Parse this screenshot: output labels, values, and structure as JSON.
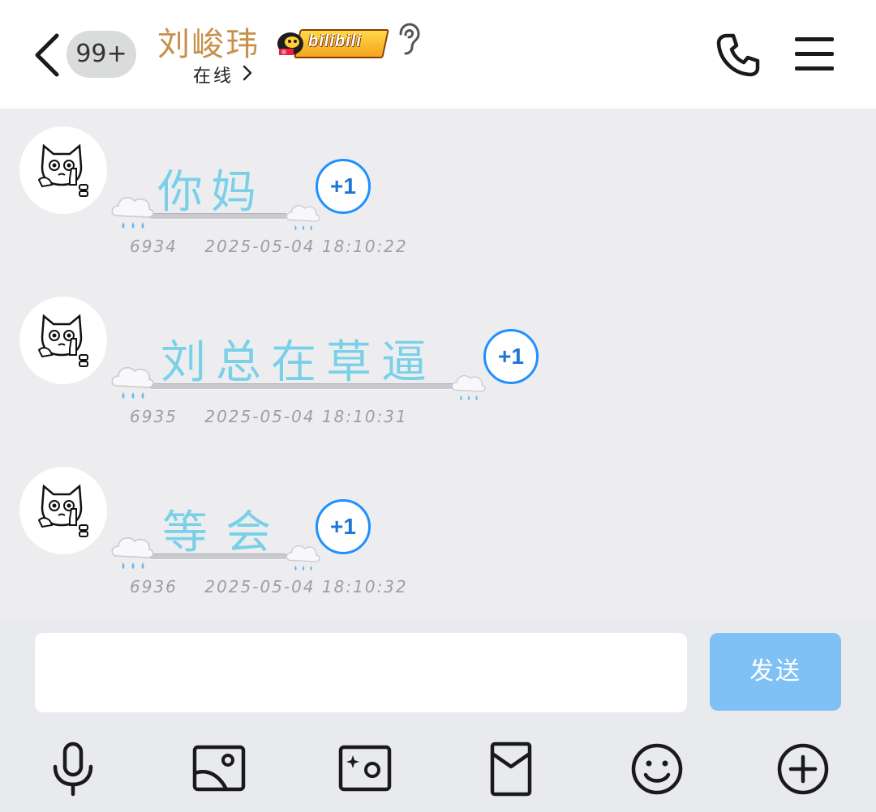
{
  "header": {
    "unread_badge": "99+",
    "contact_name": "刘峻玮",
    "title_tag": "bilibili",
    "status": "在线"
  },
  "messages": [
    {
      "text": "你妈",
      "id": "6934",
      "time": "2025-05-04 18:10:22",
      "plus_label": "+1"
    },
    {
      "text": "刘总在草逼",
      "id": "6935",
      "time": "2025-05-04 18:10:31",
      "plus_label": "+1"
    },
    {
      "text": "等会",
      "id": "6936",
      "time": "2025-05-04 18:10:32",
      "plus_label": "+1"
    }
  ],
  "composer": {
    "input_value": "",
    "send_label": "发送"
  },
  "toolbar": {
    "icons": [
      "microphone-icon",
      "image-icon",
      "camera-icon",
      "red-packet-icon",
      "emoji-icon",
      "plus-circle-icon"
    ]
  },
  "colors": {
    "accent_blue": "#1e90ff",
    "send_button": "#7fc1f4",
    "message_text": "#7ecfe6",
    "name_color": "#c6904a"
  }
}
